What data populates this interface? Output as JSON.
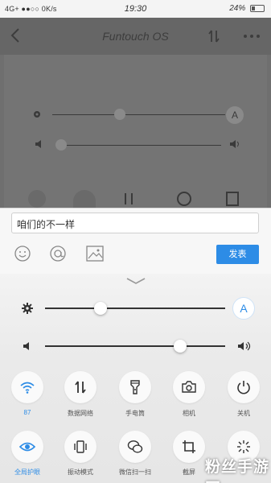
{
  "status_bar": {
    "network": "4G+ ●●○○ 0K/s",
    "time": "19:30",
    "battery": "24%"
  },
  "app_bar": {
    "title": "Funtouch OS"
  },
  "composer": {
    "input_value": "咱们的不一样",
    "send_label": "发表"
  },
  "control_center": {
    "brightness_level": 0.31,
    "volume_level": 0.75,
    "auto_brightness_label": "A",
    "toggles_row1": [
      {
        "icon": "wifi-icon",
        "label": "87",
        "active": true
      },
      {
        "icon": "mobile-data-icon",
        "label": "数据网络",
        "active": false
      },
      {
        "icon": "flashlight-icon",
        "label": "手电筒",
        "active": false
      },
      {
        "icon": "camera-icon",
        "label": "相机",
        "active": false
      },
      {
        "icon": "power-icon",
        "label": "关机",
        "active": false
      }
    ],
    "toggles_row2": [
      {
        "icon": "eye-icon",
        "label": "全局护眼",
        "active": true
      },
      {
        "icon": "vibrate-icon",
        "label": "振动模式",
        "active": false
      },
      {
        "icon": "wechat-icon",
        "label": "微信扫一扫",
        "active": false
      },
      {
        "icon": "screenshot-icon",
        "label": "截屏",
        "active": false
      },
      {
        "icon": "sparkle-icon",
        "label": "",
        "active": false
      }
    ]
  },
  "watermark": "粉丝手游网",
  "colors": {
    "accent": "#2d8ce6"
  }
}
